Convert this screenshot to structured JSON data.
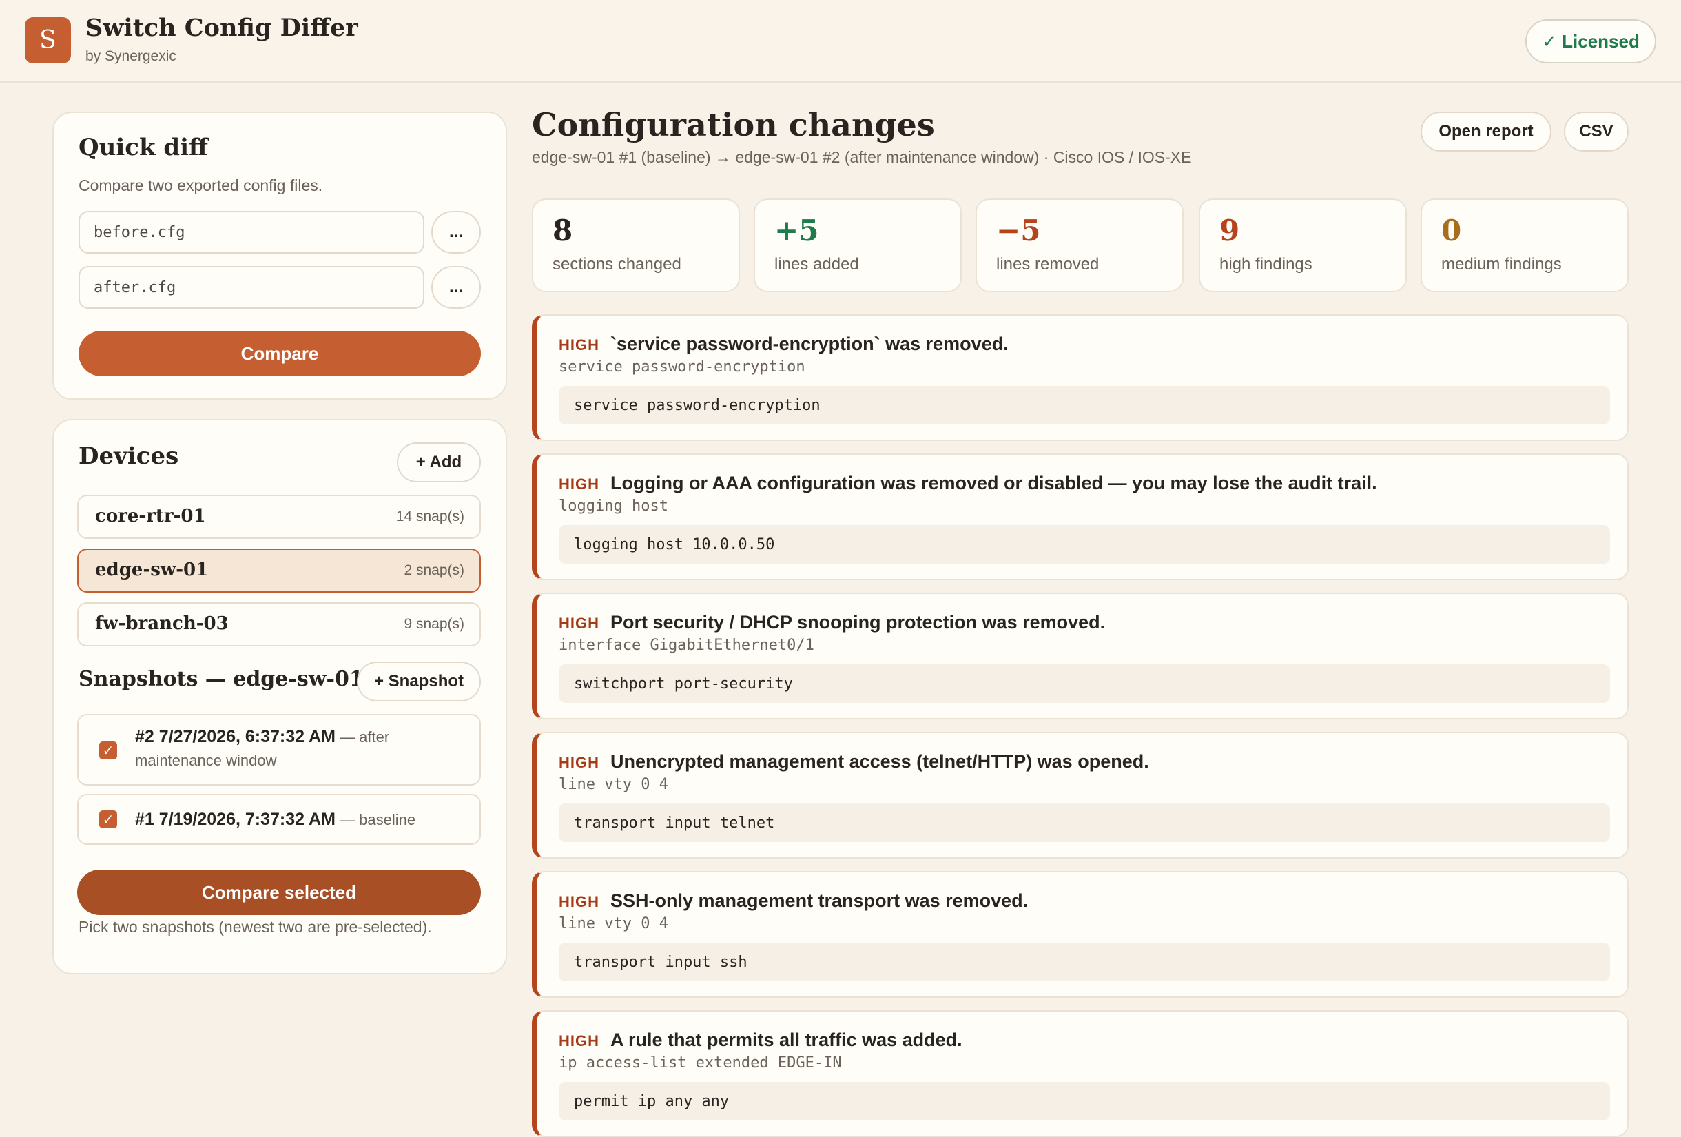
{
  "app": {
    "logo_letter": "S",
    "title": "Switch Config Differ",
    "subtitle": "by Synergexic",
    "license_badge": "✓ Licensed"
  },
  "quick_diff": {
    "title": "Quick diff",
    "description": "Compare two exported config files.",
    "before_value": "before.cfg",
    "after_value": "after.cfg",
    "browse_label": "...",
    "compare_label": "Compare"
  },
  "devices": {
    "title": "Devices",
    "add_label": "+ Add",
    "items": [
      {
        "name": "core-rtr-01",
        "count": "14 snap(s)"
      },
      {
        "name": "edge-sw-01",
        "count": "2 snap(s)"
      },
      {
        "name": "fw-branch-03",
        "count": "9 snap(s)"
      }
    ]
  },
  "snapshots": {
    "title": "Snapshots — edge-sw-01",
    "add_label": "+ Snapshot",
    "items": [
      {
        "id": "#2 7/27/2026, 6:37:32 AM",
        "note_line1": " — after",
        "note_line2": "maintenance window",
        "checked": "✓"
      },
      {
        "id": "#1 7/19/2026, 7:37:32 AM",
        "note_line1": " — baseline",
        "checked": "✓"
      }
    ],
    "compare_selected_label": "Compare selected",
    "hint": "Pick two snapshots (newest two are pre-selected)."
  },
  "main": {
    "title": "Configuration changes",
    "subtitle": "edge-sw-01 #1 (baseline) → edge-sw-01 #2 (after maintenance window) · Cisco IOS / IOS-XE",
    "open_report_label": "Open report",
    "csv_label": "CSV",
    "stats": [
      {
        "value": "8",
        "label": "sections changed",
        "color": "#2a2420"
      },
      {
        "value": "+5",
        "label": "lines added",
        "color": "#1f7a4d"
      },
      {
        "value": "−5",
        "label": "lines removed",
        "color": "#b5441d"
      },
      {
        "value": "9",
        "label": "high findings",
        "color": "#b5441d"
      },
      {
        "value": "0",
        "label": "medium findings",
        "color": "#a86e1c"
      }
    ],
    "findings": [
      {
        "severity": "HIGH",
        "title": "`service password-encryption` was removed.",
        "path": "service password-encryption",
        "code": "service password-encryption"
      },
      {
        "severity": "HIGH",
        "title": "Logging or AAA configuration was removed or disabled — you may lose the audit trail.",
        "path": "logging host",
        "code": "logging host 10.0.0.50"
      },
      {
        "severity": "HIGH",
        "title": "Port security / DHCP snooping protection was removed.",
        "path": "interface GigabitEthernet0/1",
        "code": "switchport port-security"
      },
      {
        "severity": "HIGH",
        "title": "Unencrypted management access (telnet/HTTP) was opened.",
        "path": "line vty 0 4",
        "code": "transport input telnet"
      },
      {
        "severity": "HIGH",
        "title": "SSH-only management transport was removed.",
        "path": "line vty 0 4",
        "code": "transport input ssh"
      },
      {
        "severity": "HIGH",
        "title": "A rule that permits all traffic was added.",
        "path": "ip access-list extended EDGE-IN",
        "code": "permit ip any any"
      }
    ]
  }
}
